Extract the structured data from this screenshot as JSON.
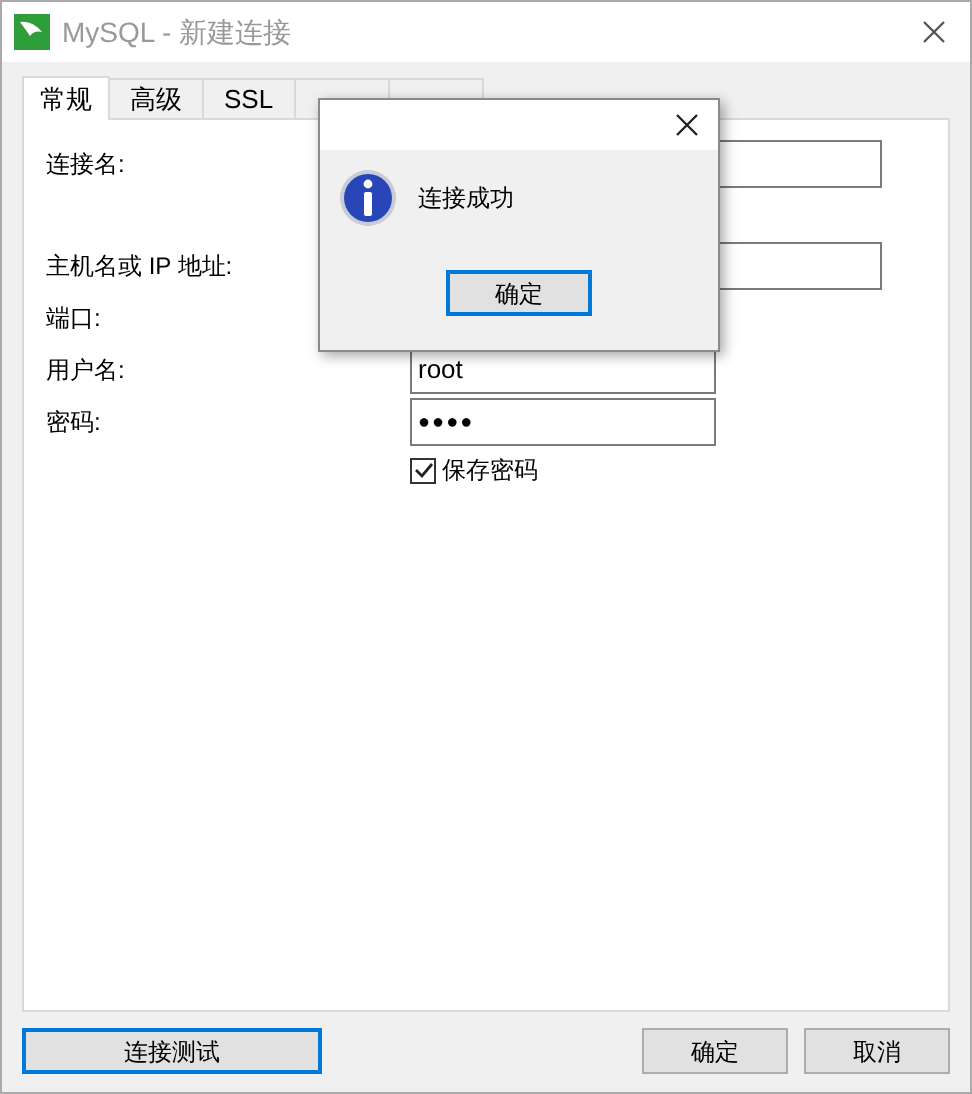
{
  "window": {
    "title": "MySQL - 新建连接"
  },
  "tabs": [
    {
      "label": "常规",
      "selected": true
    },
    {
      "label": "高级",
      "selected": false
    },
    {
      "label": "SSL",
      "selected": false
    },
    {
      "selected": false
    },
    {
      "selected": false
    }
  ],
  "fields": [
    {
      "label": "连接名:",
      "kind": "wide"
    },
    {
      "label": "主机名或 IP 地址:",
      "kind": "wide"
    },
    {
      "label": "端口:",
      "kind": "hidden"
    },
    {
      "label": "用户名:",
      "kind": "text",
      "value": "root"
    },
    {
      "label": "密码:",
      "kind": "password",
      "value": "●●●●"
    }
  ],
  "save_password": {
    "label": "保存密码",
    "checked": true
  },
  "buttons": {
    "test": "连接测试",
    "ok": "确定",
    "cancel": "取消"
  },
  "dialog": {
    "message": "连接成功",
    "button": "确定"
  }
}
